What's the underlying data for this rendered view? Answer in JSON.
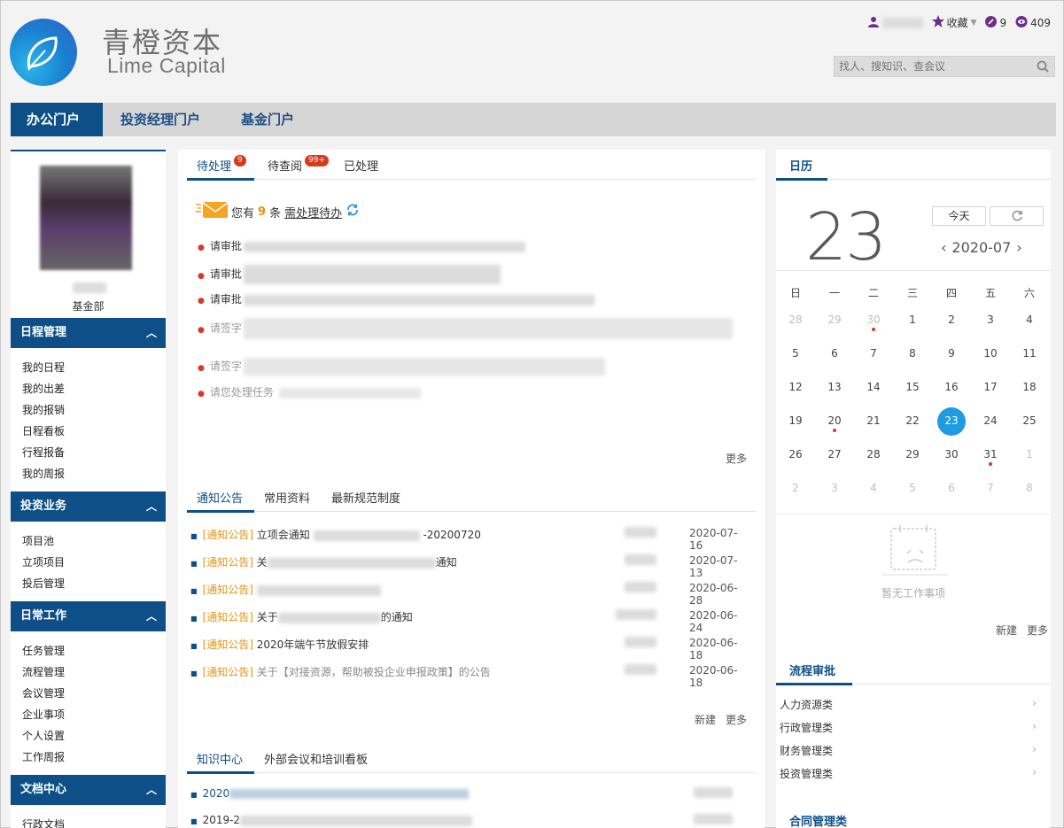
{
  "header": {
    "logo_cn": "青橙资本",
    "logo_en": "Lime Capital",
    "favorites": "收藏",
    "edit_count": "9",
    "view_count": "409",
    "search_placeholder": "找人、搜知识、查会议"
  },
  "nav": {
    "tabs": [
      {
        "label": "办公门户",
        "active": true
      },
      {
        "label": "投资经理门户",
        "active": false
      },
      {
        "label": "基金门户",
        "active": false
      }
    ]
  },
  "sidebar": {
    "dept": "基金部",
    "sections": [
      {
        "title": "日程管理",
        "items": [
          "我的日程",
          "我的出差",
          "我的报销",
          "日程看板",
          "行程报备",
          "我的周报"
        ]
      },
      {
        "title": "投资业务",
        "items": [
          "项目池",
          "立项项目",
          "投后管理"
        ]
      },
      {
        "title": "日常工作",
        "items": [
          "任务管理",
          "流程管理",
          "会议管理",
          "企业事项",
          "个人设置",
          "工作周报"
        ]
      },
      {
        "title": "文档中心",
        "items": [
          "行政文档"
        ]
      }
    ]
  },
  "pending": {
    "tabs": [
      {
        "label": "待处理",
        "badge": "9"
      },
      {
        "label": "待查阅",
        "badge": "99+"
      },
      {
        "label": "已处理",
        "badge": ""
      }
    ],
    "summary_prefix": "您有",
    "summary_count": "9",
    "summary_mid": "条",
    "summary_link": "需处理待办",
    "items": [
      "请审批",
      "请审批",
      "请审批",
      "请签字",
      "请签字",
      "请您处理任务"
    ],
    "more": "更多"
  },
  "notices": {
    "tabs": [
      "通知公告",
      "常用资料",
      "最新规范制度"
    ],
    "items": [
      {
        "tag": "[通知公告]",
        "title_a": "立项会通知",
        "title_b": "-20200720",
        "date": "2020-07-16"
      },
      {
        "tag": "[通知公告]",
        "title_a": "关",
        "title_b": "通知",
        "date": "2020-07-13"
      },
      {
        "tag": "[通知公告]",
        "title_a": "",
        "title_b": "",
        "date": "2020-06-28"
      },
      {
        "tag": "[通知公告]",
        "title_a": "关于",
        "title_b": "的通知",
        "date": "2020-06-24"
      },
      {
        "tag": "[通知公告]",
        "title_a": "2020年端午节放假安排",
        "title_b": "",
        "date": "2020-06-18"
      },
      {
        "tag": "[通知公告]",
        "title_a": "关于【对接资源，帮助被投企业申报政策】的公告",
        "title_b": "",
        "date": "2020-06-18"
      }
    ],
    "new": "新建",
    "more": "更多"
  },
  "knowledge": {
    "tabs": [
      "知识中心",
      "外部会议和培训看板"
    ],
    "items": [
      "2020",
      "2019-2"
    ]
  },
  "calendar": {
    "title": "日历",
    "big_day": "23",
    "today_btn": "今天",
    "month": "2020-07",
    "weekdays": [
      "日",
      "一",
      "二",
      "三",
      "四",
      "五",
      "六"
    ],
    "weeks": [
      [
        "28",
        "29",
        "30",
        "1",
        "2",
        "3",
        "4"
      ],
      [
        "5",
        "6",
        "7",
        "8",
        "9",
        "10",
        "11"
      ],
      [
        "12",
        "13",
        "14",
        "15",
        "16",
        "17",
        "18"
      ],
      [
        "19",
        "20",
        "21",
        "22",
        "23",
        "24",
        "25"
      ],
      [
        "26",
        "27",
        "28",
        "29",
        "30",
        "31",
        "1"
      ],
      [
        "2",
        "3",
        "4",
        "5",
        "6",
        "7",
        "8"
      ]
    ],
    "empty_text": "暂无工作事项",
    "new": "新建",
    "more": "更多"
  },
  "flow": {
    "title": "流程审批",
    "items": [
      "人力资源类",
      "行政管理类",
      "财务管理类",
      "投资管理类"
    ],
    "contract_title": "合同管理类"
  }
}
